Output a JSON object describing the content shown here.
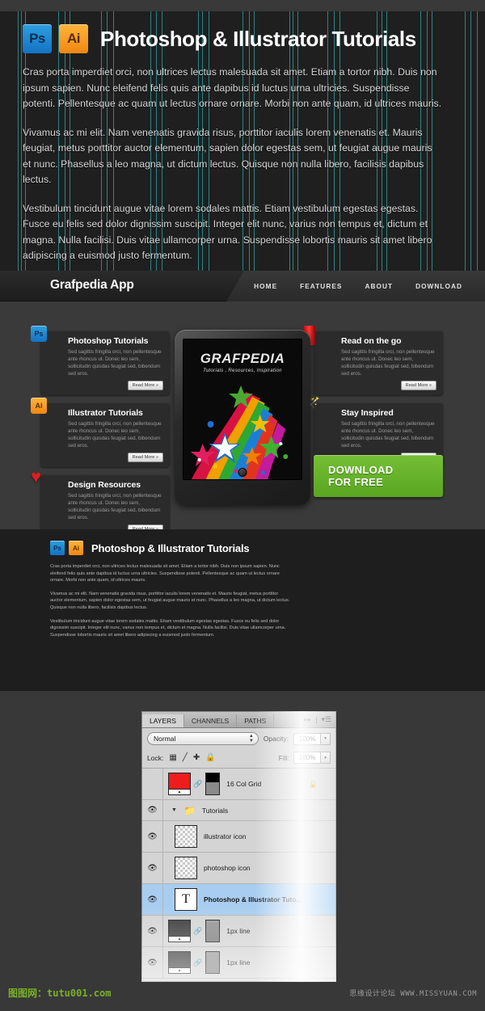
{
  "hero": {
    "badges": [
      {
        "icon": "photoshop-badge-icon",
        "label": "Ps"
      },
      {
        "icon": "illustrator-badge-icon",
        "label": "Ai"
      }
    ],
    "title": "Photoshop & Illustrator Tutorials",
    "paragraphs": [
      "Cras porta imperdiet orci, non ultrices lectus malesuada sit amet. Etiam a tortor nibh. Duis non ipsum sapien. Nunc eleifend felis quis ante dapibus id luctus urna ultricies. Suspendisse potenti. Pellentesque ac quam ut lectus ornare ornare. Morbi non ante quam, id ultrices mauris.",
      "Vivamus ac mi elit. Nam venenatis gravida risus, porttitor iaculis lorem venenatis et. Mauris feugiat, metus porttitor auctor elementum, sapien dolor egestas sem, ut feugiat augue mauris et nunc. Phasellus a leo magna, ut dictum lectus. Quisque non nulla libero, facilisis dapibus lectus.",
      "Vestibulum tincidunt augue vitae lorem sodales mattis. Etiam vestibulum egestas egestas. Fusce eu felis sed dolor dignissim suscipit. Integer elit nunc, varius non tempus et, dictum et magna. Nulla facilisi. Duis vitae ullamcorper urna. Suspendisse lobortis mauris sit amet libero adipiscing a euismod justo fermentum."
    ],
    "guide_color": "#2f8d8d",
    "guide_positions": [
      22,
      26,
      31,
      72,
      80,
      86,
      125,
      132,
      140,
      186,
      193,
      200,
      245,
      250,
      258,
      300,
      308,
      314,
      358,
      362,
      368,
      405,
      413,
      420,
      466,
      472,
      478,
      520,
      528,
      534,
      575,
      582,
      590
    ]
  },
  "nav": {
    "brand": "Grafpedia App",
    "items": [
      {
        "label": "HOME"
      },
      {
        "label": "FEATURES"
      },
      {
        "label": "ABOUT"
      },
      {
        "label": "DOWNLOAD"
      }
    ]
  },
  "features": {
    "body_text": "Sed sagittis fringilla orci, non pellentesque ante rhoncus ut. Donec leo sem, sollicitudin quisdas feugiat sed, bibendum sed eros.",
    "read_more": "Read More »",
    "left_cards": [
      {
        "icon": "photoshop-badge-icon",
        "icon_label": "Ps",
        "title": "Photoshop Tutorials"
      },
      {
        "icon": "illustrator-badge-icon",
        "icon_label": "Ai",
        "title": "Illustrator Tutorials"
      },
      {
        "icon": "heart-icon",
        "icon_label": "♥",
        "title": "Design Resources"
      }
    ],
    "right_cards": [
      {
        "icon": "book-icon",
        "icon_label": "",
        "title": "Read on the go"
      },
      {
        "icon": "magic-wand-icon",
        "icon_label": "✦",
        "title": "Stay Inspired"
      }
    ]
  },
  "tablet": {
    "screen_title": "GRAFPEDIA",
    "screen_subtitle": "Tutorials , Resources, Inspiration"
  },
  "download": {
    "line1": "DOWNLOAD",
    "line2": "FOR FREE",
    "color": "#5aa521"
  },
  "section2": {
    "badges": [
      {
        "icon": "photoshop-badge-icon",
        "label": "Ps"
      },
      {
        "icon": "illustrator-badge-icon",
        "label": "Ai"
      }
    ],
    "title": "Photoshop & Illustrator Tutorials",
    "paragraphs": [
      "Cras porta imperdiet orci, non ultrices lectus malesuada sit amet. Etiam a tortor nibh. Duis non ipsum sapien. Nunc eleifend felis quis ante dapibus id luctus urna ultricies. Suspendisse potenti. Pellentesque ac quam ut lectus ornare ornare. Morbi non ante quam, id ultrices mauris.",
      "Vivamus ac mi elit. Nam venenatis gravida risus, porttitor iaculis lorem venenatis et. Mauris feugiat, metus porttitor auctor elementum, sapien dolor egestas sem, ut feugiat augue mauris et nunc. Phasellus a leo magna, ut dictum lectus. Quisque non nulla libero, facilisis dapibus lectus.",
      "Vestibulum tincidunt augue vitae lorem sodales mattis. Etiam vestibulum egestas egestas. Fusce eu felis sed dolor dignissim suscipit. Integer elit nunc, varius non tempus et, dictum et magna. Nulla facilisi. Duis vitae ullamcorper urna. Suspendisse lobortis mauris sit amet libero adipiscing a euismod justo fermentum."
    ]
  },
  "layers_panel": {
    "tabs": [
      {
        "label": "LAYERS",
        "active": true
      },
      {
        "label": "CHANNELS",
        "active": false
      },
      {
        "label": "PATHS",
        "active": false
      }
    ],
    "blend_mode": "Normal",
    "opacity_label": "Opacity:",
    "opacity_value": "100%",
    "lock_label": "Lock:",
    "fill_label": "Fill:",
    "fill_value": "100%",
    "lock_icons": [
      "transparency-lock-icon",
      "brush-lock-icon",
      "move-lock-icon",
      "all-lock-icon"
    ],
    "layers": [
      {
        "name": "16 Col Grid",
        "visible": false,
        "locked": true,
        "selected": false,
        "thumb": "red",
        "mask": true,
        "link": true,
        "type": "layer"
      },
      {
        "name": "Tutorials",
        "visible": true,
        "locked": false,
        "selected": false,
        "thumb": "folder",
        "mask": false,
        "link": false,
        "type": "group"
      },
      {
        "name": "illustrator icon",
        "visible": true,
        "locked": false,
        "selected": false,
        "thumb": "checker",
        "mask": false,
        "link": false,
        "type": "layer"
      },
      {
        "name": "photoshop icon",
        "visible": true,
        "locked": false,
        "selected": false,
        "thumb": "checker",
        "mask": false,
        "link": false,
        "type": "layer"
      },
      {
        "name": "Photoshop & Illustrator Tuto...",
        "visible": true,
        "locked": false,
        "selected": true,
        "thumb": "text",
        "mask": false,
        "link": false,
        "type": "text"
      },
      {
        "name": "1px line",
        "visible": true,
        "locked": false,
        "selected": false,
        "thumb": "dark",
        "mask": true,
        "link": true,
        "type": "layer"
      },
      {
        "name": "1px line",
        "visible": true,
        "locked": false,
        "selected": false,
        "thumb": "dark",
        "mask": true,
        "link": true,
        "type": "layer"
      }
    ]
  },
  "watermarks": {
    "left": "图图网：tutu001.com",
    "right": "思缘设计论坛 WWW.MISSYUAN.COM"
  }
}
